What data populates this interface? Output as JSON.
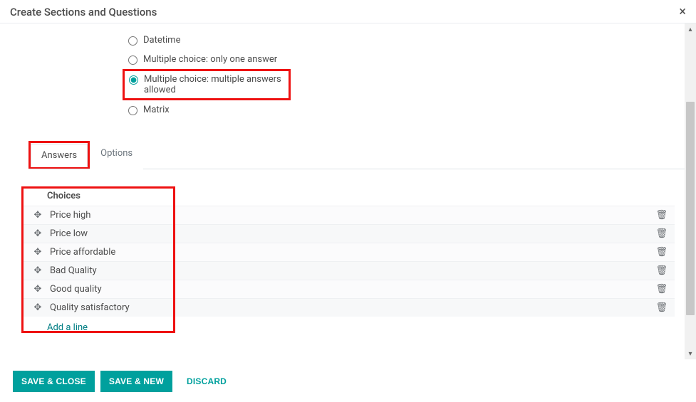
{
  "header": {
    "title": "Create Sections and Questions",
    "close": "×"
  },
  "question_types": {
    "datetime": "Datetime",
    "multi_one": "Multiple choice: only one answer",
    "multi_many": "Multiple choice: multiple answers allowed",
    "matrix": "Matrix"
  },
  "tabs": {
    "answers": "Answers",
    "options": "Options"
  },
  "choices": {
    "header": "Choices",
    "items": [
      "Price high",
      "Price low",
      "Price affordable",
      "Bad Quality",
      "Good quality",
      "Quality satisfactory"
    ],
    "add_line": "Add a line"
  },
  "footer": {
    "save_close": "SAVE & CLOSE",
    "save_new": "SAVE & NEW",
    "discard": "DISCARD"
  },
  "icons": {
    "drag": "✥",
    "trash": "🗑",
    "chev_up": "▴",
    "chev_down": "▾"
  }
}
